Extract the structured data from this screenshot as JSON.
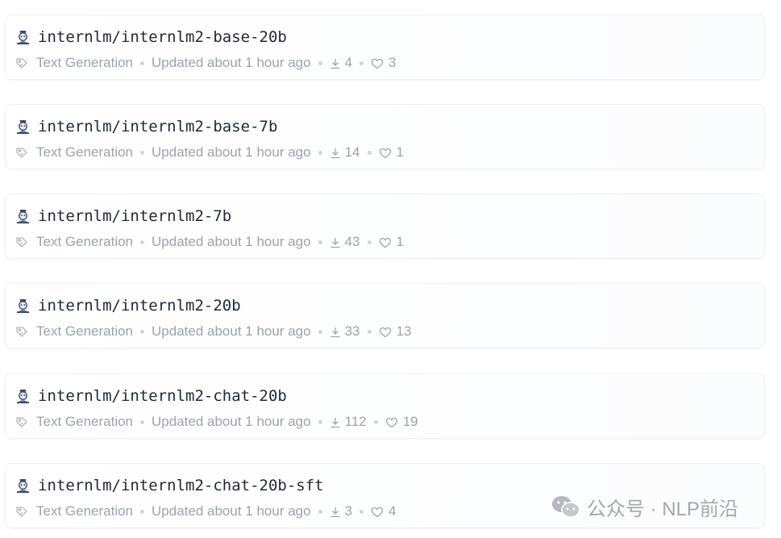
{
  "models": [
    {
      "name": "internlm/internlm2-base-20b",
      "task": "Text Generation",
      "updated": "Updated about 1 hour ago",
      "downloads": "4",
      "likes": "3"
    },
    {
      "name": "internlm/internlm2-base-7b",
      "task": "Text Generation",
      "updated": "Updated about 1 hour ago",
      "downloads": "14",
      "likes": "1"
    },
    {
      "name": "internlm/internlm2-7b",
      "task": "Text Generation",
      "updated": "Updated about 1 hour ago",
      "downloads": "43",
      "likes": "1"
    },
    {
      "name": "internlm/internlm2-20b",
      "task": "Text Generation",
      "updated": "Updated about 1 hour ago",
      "downloads": "33",
      "likes": "13"
    },
    {
      "name": "internlm/internlm2-chat-20b",
      "task": "Text Generation",
      "updated": "Updated about 1 hour ago",
      "downloads": "112",
      "likes": "19"
    },
    {
      "name": "internlm/internlm2-chat-20b-sft",
      "task": "Text Generation",
      "updated": "Updated about 1 hour ago",
      "downloads": "3",
      "likes": "4"
    }
  ],
  "icons": {
    "avatar": "org-avatar-icon",
    "task": "tag-icon",
    "downloads": "download-icon",
    "likes": "heart-icon",
    "watermark": "wechat-icon"
  },
  "watermark": {
    "text": "公众号 · NLP前沿"
  },
  "colors": {
    "text_primary": "#1f2937",
    "text_muted": "#9ca3af",
    "card_border": "#eef0f3"
  }
}
